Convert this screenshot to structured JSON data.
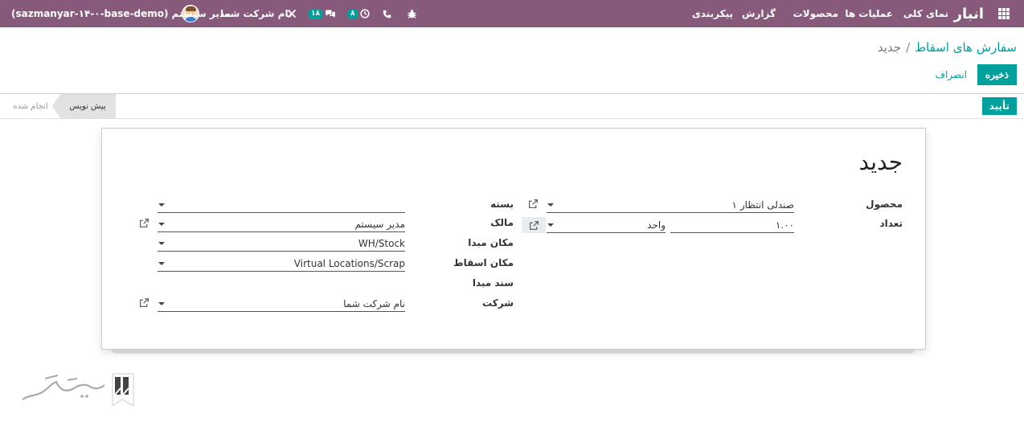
{
  "navbar": {
    "brand": "انبار",
    "menu": [
      "نمای کلی",
      "عملیات ها",
      "محصولات",
      "گزارش",
      "پیکربندی"
    ],
    "activity_count": "۸",
    "messages_count": "۱۸",
    "company": "نام شرکت شما",
    "user": "مدیر سیستم",
    "db": "(sazmanyar-۱۴-۰-base-demo)"
  },
  "breadcrumb": {
    "parent": "سفارش های اسقاط",
    "separator": "/",
    "current": "جدید"
  },
  "buttons": {
    "save": "ذخیره",
    "discard": "انصراف",
    "confirm": "تأیید"
  },
  "statusbar": {
    "draft": "پیش نویس",
    "done": "انجام شده"
  },
  "form": {
    "title": "جدید",
    "labels": {
      "product": "محصول",
      "quantity": "تعداد",
      "package": "بسته",
      "owner": "مالک",
      "source_location": "مکان مبدا",
      "scrap_location": "مکان اسقاط",
      "source_document": "سند مبدا",
      "company": "شرکت"
    },
    "values": {
      "product": "صندلی انتظار ۱",
      "quantity": "۱.۰۰",
      "uom": "واحد",
      "package": "",
      "owner": "مدیر سیستم",
      "source_location": "WH/Stock",
      "scrap_location": "Virtual Locations/Scrap",
      "source_document": "",
      "company": "نام شرکت شما"
    }
  }
}
